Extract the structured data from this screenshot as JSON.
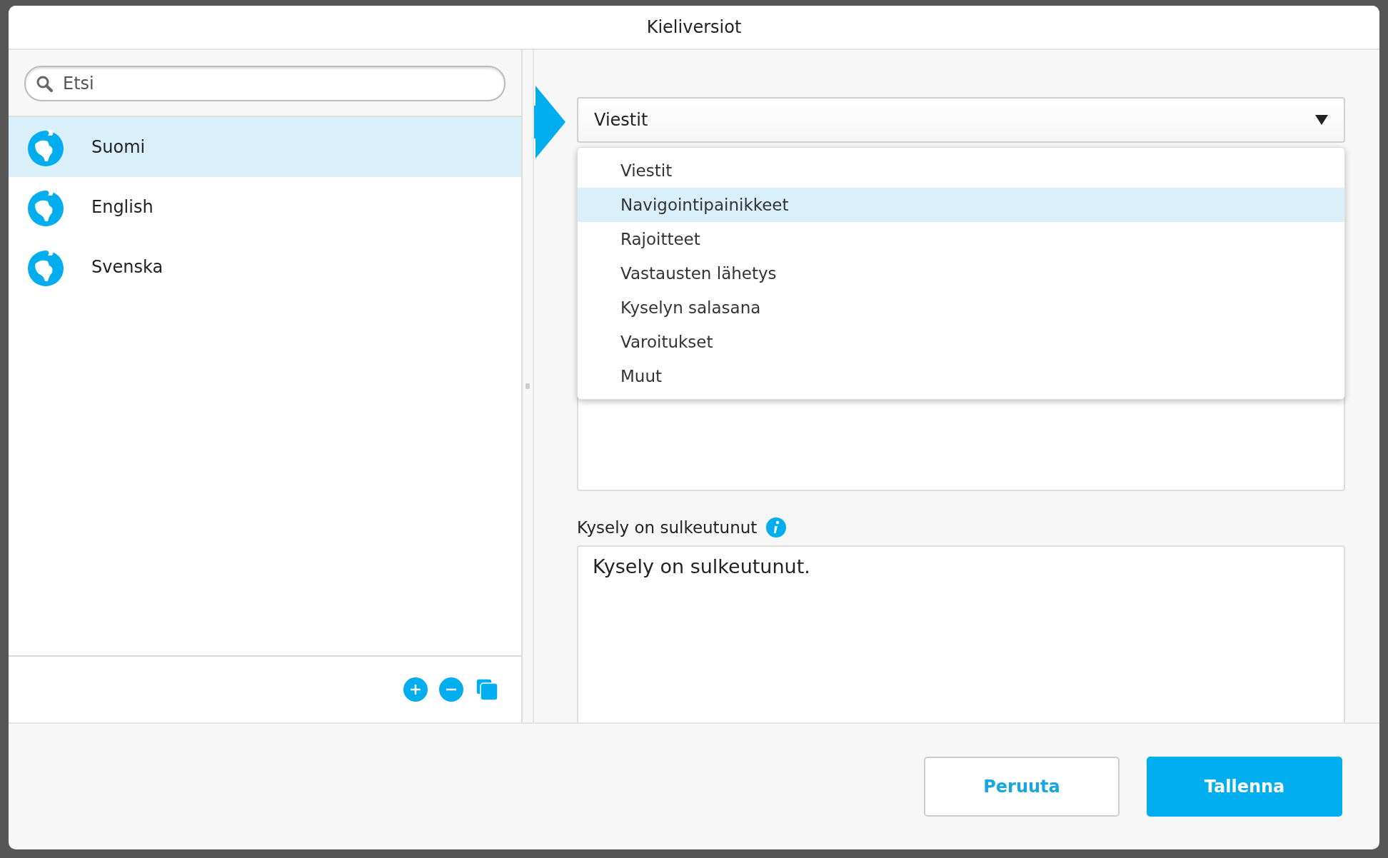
{
  "dialog": {
    "title": "Kieliversiot"
  },
  "search": {
    "placeholder": "Etsi"
  },
  "languages": [
    {
      "name": "Suomi",
      "selected": true
    },
    {
      "name": "English",
      "selected": false
    },
    {
      "name": "Svenska",
      "selected": false
    }
  ],
  "section_select": {
    "value": "Viestit",
    "options": [
      {
        "label": "Viestit",
        "highlighted": false
      },
      {
        "label": "Navigointipainikkeet",
        "highlighted": true
      },
      {
        "label": "Rajoitteet",
        "highlighted": false
      },
      {
        "label": "Vastausten lähetys",
        "highlighted": false
      },
      {
        "label": "Kyselyn salasana",
        "highlighted": false
      },
      {
        "label": "Varoitukset",
        "highlighted": false
      },
      {
        "label": "Muut",
        "highlighted": false
      }
    ]
  },
  "field": {
    "label": "Kysely on sulkeutunut",
    "value": "Kysely on sulkeutunut."
  },
  "buttons": [
    {
      "label": "Peruuta",
      "kind": "secondary"
    },
    {
      "label": "Tallenna",
      "kind": "primary"
    }
  ]
}
